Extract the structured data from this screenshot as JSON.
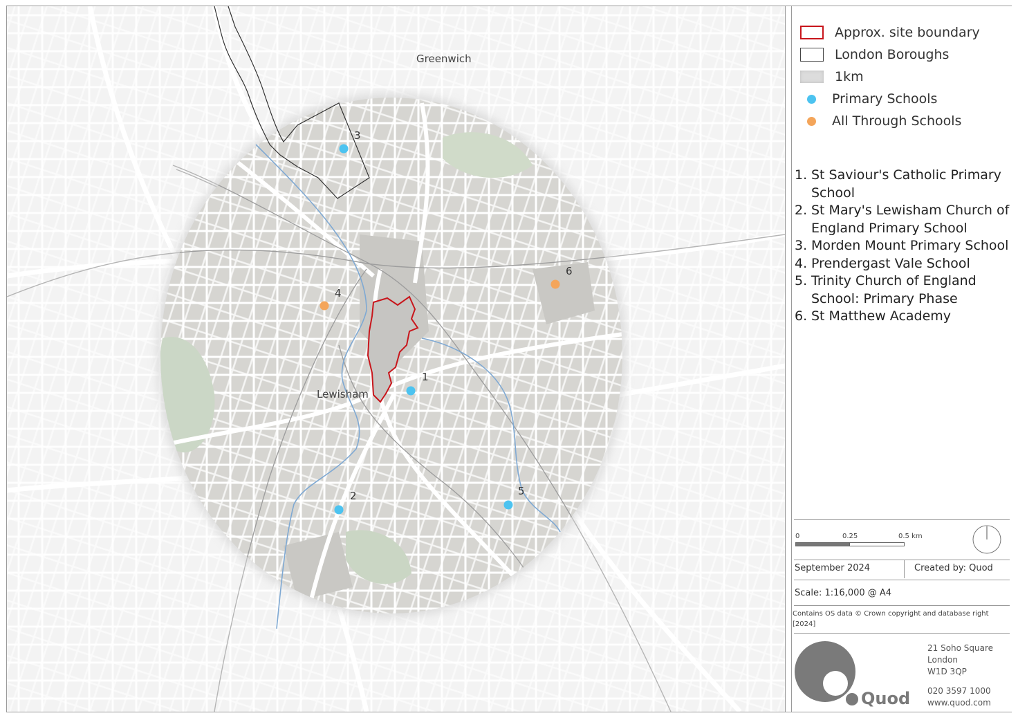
{
  "legend": {
    "items": [
      {
        "label": "Approx. site boundary",
        "symbol": "site",
        "color": "#c8161c"
      },
      {
        "label": "London Boroughs",
        "symbol": "borough",
        "color": "#444444"
      },
      {
        "label": "1km",
        "symbol": "buffer",
        "color": "#dcdcdc"
      },
      {
        "label": "Primary Schools",
        "symbol": "dot",
        "color": "#4cc3f0"
      },
      {
        "label": "All Through Schools",
        "symbol": "dot",
        "color": "#f4a55a"
      }
    ]
  },
  "schools": [
    {
      "num": "1.",
      "name": "St Saviour's Catholic Primary School"
    },
    {
      "num": "2.",
      "name": "St Mary's Lewisham Church of England Primary School"
    },
    {
      "num": "3.",
      "name": "Morden Mount Primary School"
    },
    {
      "num": "4.",
      "name": "Prendergast Vale School"
    },
    {
      "num": "5.",
      "name": "Trinity Church of England School: Primary Phase"
    },
    {
      "num": "6.",
      "name": "St Matthew Academy"
    }
  ],
  "map": {
    "place_labels": {
      "greenwich": "Greenwich",
      "lewisham": "Lewisham"
    },
    "markers": [
      {
        "label": "1",
        "type": "primary"
      },
      {
        "label": "2",
        "type": "primary"
      },
      {
        "label": "3",
        "type": "primary"
      },
      {
        "label": "4",
        "type": "all_through"
      },
      {
        "label": "5",
        "type": "primary"
      },
      {
        "label": "6",
        "type": "all_through"
      }
    ]
  },
  "scalebar": {
    "ticks": [
      "0",
      "0.25",
      "0.5 km"
    ]
  },
  "info": {
    "date": "September 2024",
    "created_by": "Created by: Quod",
    "scale": "Scale: 1:16,000 @ A4",
    "copyright": "Contains OS data © Crown copyright and database right [2024]"
  },
  "company": {
    "name": "Quod",
    "address": [
      "21 Soho Square",
      "London",
      "W1D 3QP"
    ],
    "phone": "020 3597 1000",
    "web": "www.quod.com"
  }
}
